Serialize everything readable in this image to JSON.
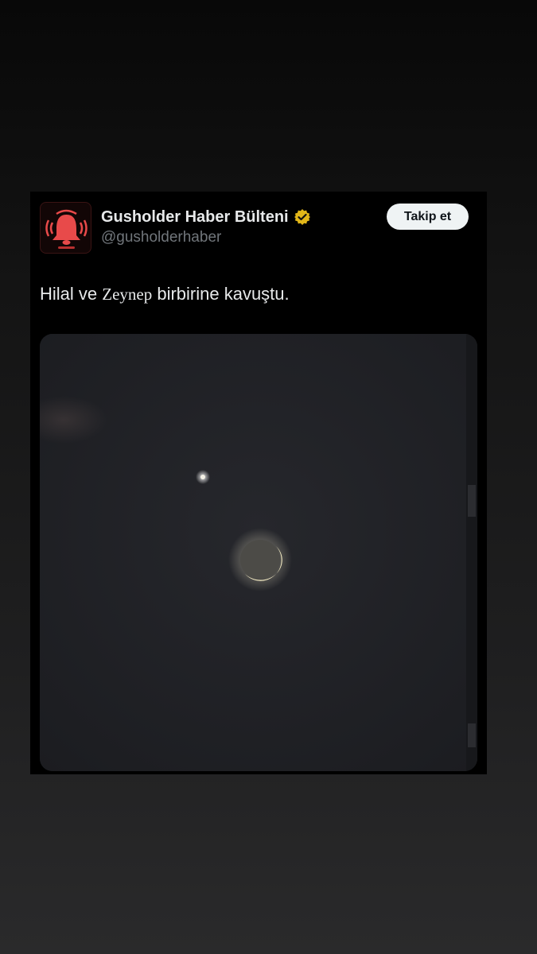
{
  "post": {
    "author": {
      "display_name": "Gusholder Haber Bülteni",
      "handle": "@gusholderhaber",
      "verified": true,
      "avatar_icon": "alarm-bell-icon",
      "badge_icon": "verified-badge-icon"
    },
    "follow_button_label": "Takip et",
    "text": {
      "before": "Hilal ve ",
      "highlight": "Zeynep",
      "after": " birbirine kavuştu."
    },
    "media": {
      "type": "video-still",
      "subject": "crescent-moon-and-planet-icon"
    }
  },
  "colors": {
    "card_bg": "#000000",
    "primary_text": "#e7e9ea",
    "secondary_text": "#71767b",
    "button_bg": "#eff3f4",
    "badge_gold": "#e2b719",
    "bell_red": "#e84a4a"
  }
}
